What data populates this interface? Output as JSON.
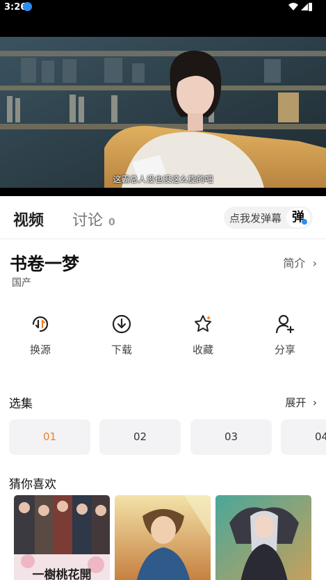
{
  "status_bar": {
    "time": "3:26"
  },
  "player": {
    "subtitle": "这霸总人设也没这么旋的吧"
  },
  "tabs": {
    "video": "视频",
    "discuss": "讨论",
    "discuss_count": "0"
  },
  "danmaku": {
    "placeholder": "点我发弹幕",
    "button": "弹"
  },
  "show": {
    "title": "书卷一梦",
    "region": "国产",
    "intro_label": "简介"
  },
  "actions": [
    {
      "label": "换源",
      "icon": "switch-source-icon"
    },
    {
      "label": "下载",
      "icon": "download-icon"
    },
    {
      "label": "收藏",
      "icon": "star-icon"
    },
    {
      "label": "分享",
      "icon": "add-user-icon"
    }
  ],
  "episodes": {
    "section_title": "选集",
    "expand_label": "展开",
    "items": [
      "01",
      "02",
      "03",
      "04"
    ],
    "active_index": 0
  },
  "recommendations": {
    "section_title": "猜你喜欢",
    "items": [
      {
        "poster_text": "一樹桃花開"
      },
      {
        "poster_text": ""
      },
      {
        "poster_text": ""
      }
    ]
  },
  "colors": {
    "accent": "#f08020",
    "chip_bg": "#f3f3f5",
    "badge_blue": "#2d8cf0"
  }
}
